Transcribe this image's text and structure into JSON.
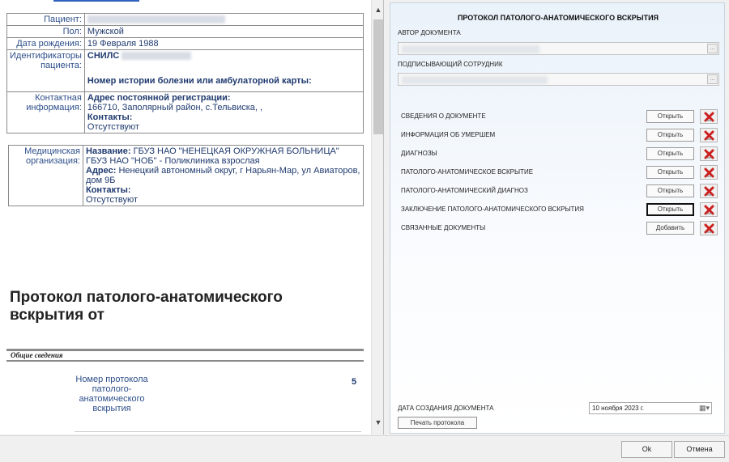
{
  "patient": {
    "rows": [
      {
        "label": "Пациент:",
        "value": ""
      },
      {
        "label": "Пол:",
        "value": "Мужской"
      },
      {
        "label": "Дата рождения:",
        "value": "19 Февраля 1988"
      }
    ],
    "identifiers_label": "Идентификаторы пациента:",
    "snils_label": "СНИЛС",
    "history_label": "Номер истории болезни или амбулаторной карты:",
    "contact_label": "Контактная информация:",
    "address_title": "Адрес постоянной регистрации:",
    "address_value": "166710, Заполярный район, с.Тельвиска, ,",
    "contacts_title": "Контакты:",
    "contacts_value": "Отсутствуют"
  },
  "organization": {
    "label": "Медицинская организация:",
    "name_title": "Название:",
    "name_value": "ГБУЗ НАО \"НЕНЕЦКАЯ ОКРУЖНАЯ БОЛЬНИЦА\"",
    "sub_value": "ГБУЗ НАО \"НОБ\" - Поликлиника взрослая",
    "address_title": "Адрес:",
    "address_value": "Ненецкий автономный округ, г Нарьян-Мар, ул Авиаторов, дом 9Б",
    "contacts_title": "Контакты:",
    "contacts_value": "Отсутствуют"
  },
  "document": {
    "title": "Протокол патолого-анатомического вскрытия от",
    "general_section": "Общие сведения",
    "protocol_number_label": "Номер протокола патолого-анатомического вскрытия",
    "protocol_number_value": "5"
  },
  "right_panel": {
    "title": "ПРОТОКОЛ ПАТОЛОГО-АНАТОМИЧЕСКОГО ВСКРЫТИЯ",
    "author_label": "АВТОР ДОКУМЕНТА",
    "signer_label": "ПОДПИСЫВАЮЩИЙ СОТРУДНИК",
    "input_button": "...",
    "sections": [
      {
        "label": "СВЕДЕНИЯ О ДОКУМЕНТЕ",
        "button": "Открыть"
      },
      {
        "label": "ИНФОРМАЦИЯ ОБ УМЕРШЕМ",
        "button": "Открыть"
      },
      {
        "label": "ДИАГНОЗЫ",
        "button": "Открыть"
      },
      {
        "label": "ПАТОЛОГО-АНАТОМИЧЕСКОЕ ВСКРЫТИЕ",
        "button": "Открыть"
      },
      {
        "label": "ПАТОЛОГО-АНАТОМИЧЕСКИЙ ДИАГНОЗ",
        "button": "Открыть"
      },
      {
        "label": "ЗАКЛЮЧЕНИЕ ПАТОЛОГО-АНАТОМИЧЕСКОГО ВСКРЫТИЯ",
        "button": "Открыть"
      },
      {
        "label": "СВЯЗАННЫЕ ДОКУМЕНТЫ",
        "button": "Добавить"
      }
    ],
    "date_label": "ДАТА СОЗДАНИЯ ДОКУМЕНТА",
    "date_value": "10  ноября  2023 г.",
    "print_button": "Печать протокола"
  },
  "dialog": {
    "ok": "Ok",
    "cancel": "Отмена"
  },
  "colors": {
    "link_blue": "#1f3a6e",
    "delete_red": "#cc1f1f"
  },
  "icons": {
    "delete": "red-x-icon",
    "calendar": "calendar-icon",
    "scroll_up": "chevron-up-icon",
    "scroll_down": "chevron-down-icon"
  }
}
